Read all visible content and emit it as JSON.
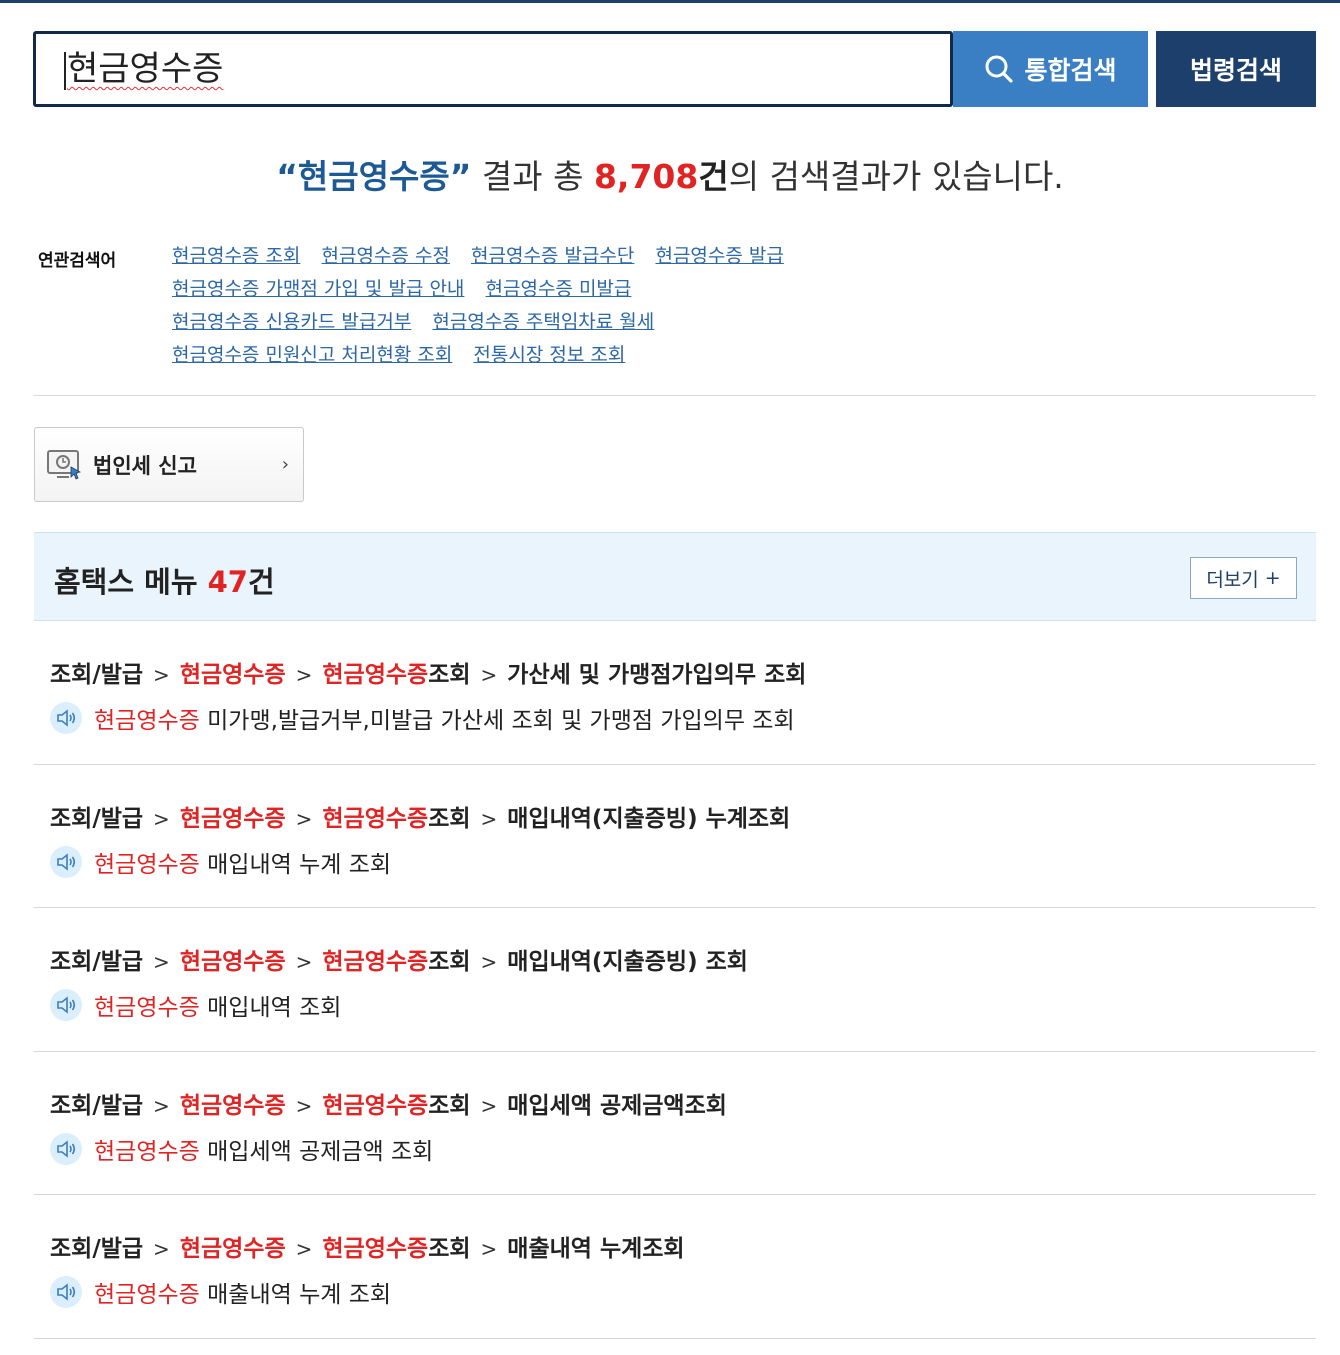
{
  "search": {
    "query": "현금영수증",
    "btn_total": "통합검색",
    "btn_law": "법령검색"
  },
  "summary": {
    "keyword": "“현금영수증”",
    "mid": " 결과 총 ",
    "count": "8,708",
    "unit": "건",
    "tail": "의 검색결과가 있습니다."
  },
  "related": {
    "label": "연관검색어",
    "lines": [
      [
        "현금영수증 조회",
        "현금영수증 수정",
        "현금영수증 발급수단",
        "현금영수증 발급"
      ],
      [
        "현금영수증 가맹점 가입 및 발급 안내",
        "현금영수증 미발급"
      ],
      [
        "현금영수증 신용카드 발급거부",
        "현금영수증 주택임차료 월세"
      ],
      [
        "현금영수증 민원신고 처리현황 조회",
        "전통시장 정보 조회"
      ]
    ]
  },
  "quick": {
    "label": "법인세 신고",
    "chevron": "›"
  },
  "menu": {
    "title": "홈택스 메뉴 ",
    "count": "47",
    "unit": "건",
    "more": "더보기",
    "more_icon": "+"
  },
  "results": [
    {
      "p1": "조회/발급",
      "p2": "현금영수증",
      "p3_hl": "현금영수증",
      "p3": "조회",
      "p4": "가산세 및 가맹점가입의무 조회",
      "d_hl": "현금영수증",
      "d": " 미가맹,발급거부,미발급 가산세 조회 및 가맹점 가입의무 조회"
    },
    {
      "p1": "조회/발급",
      "p2": "현금영수증",
      "p3_hl": "현금영수증",
      "p3": "조회",
      "p4": "매입내역(지출증빙) 누계조회",
      "d_hl": "현금영수증",
      "d": " 매입내역 누계 조회"
    },
    {
      "p1": "조회/발급",
      "p2": "현금영수증",
      "p3_hl": "현금영수증",
      "p3": "조회",
      "p4": "매입내역(지출증빙) 조회",
      "d_hl": "현금영수증",
      "d": " 매입내역 조회"
    },
    {
      "p1": "조회/발급",
      "p2": "현금영수증",
      "p3_hl": "현금영수증",
      "p3": "조회",
      "p4": "매입세액 공제금액조회",
      "d_hl": "현금영수증",
      "d": " 매입세액 공제금액 조회"
    },
    {
      "p1": "조회/발급",
      "p2": "현금영수증",
      "p3_hl": "현금영수증",
      "p3": "조회",
      "p4": "매출내역 누계조회",
      "d_hl": "현금영수증",
      "d": " 매출내역 누계 조회"
    }
  ],
  "separator": ">",
  "icons": {
    "search": "search-icon",
    "speaker": "speaker-icon",
    "quick": "tax-report-icon"
  },
  "colors": {
    "primary": "#3a7fc4",
    "dark": "#1c3f6b",
    "highlight": "#e02424",
    "link": "#2c67a8"
  }
}
